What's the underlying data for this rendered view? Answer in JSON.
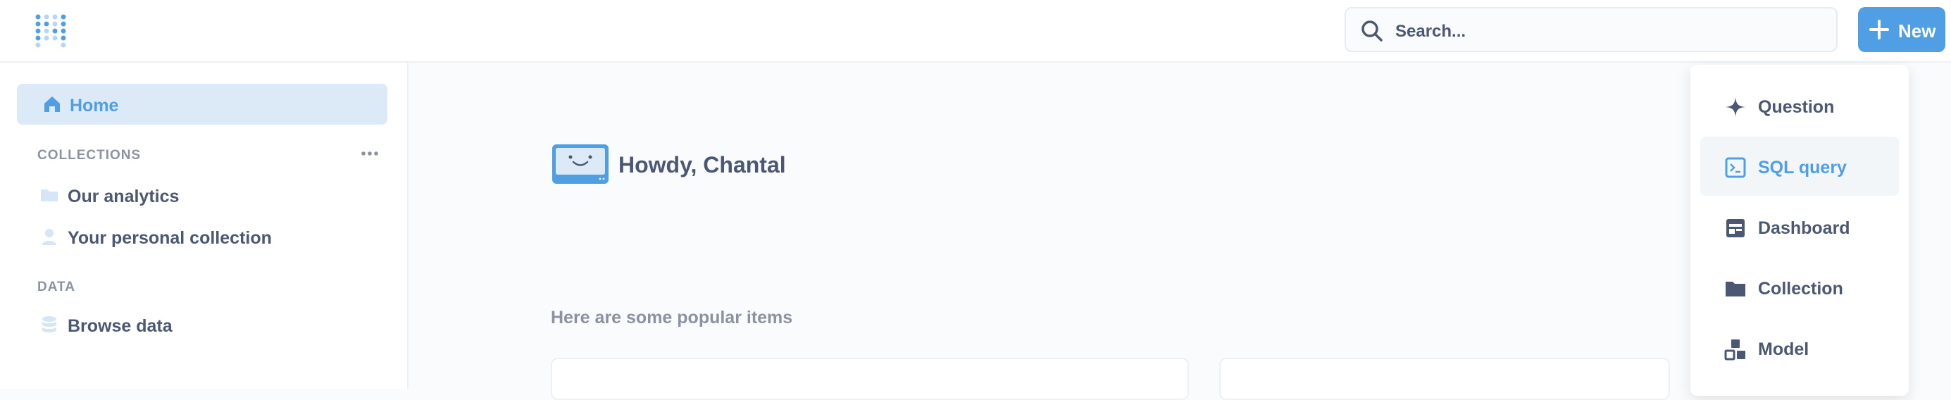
{
  "header": {
    "logo": "metabase-logo",
    "search_placeholder": "Search...",
    "new_button_label": "New"
  },
  "sidebar": {
    "home_label": "Home",
    "collections_title": "COLLECTIONS",
    "collections": [
      {
        "label": "Our analytics",
        "icon": "folder-icon"
      },
      {
        "label": "Your personal collection",
        "icon": "person-icon"
      }
    ],
    "data_title": "DATA",
    "data_items": [
      {
        "label": "Browse data",
        "icon": "database-icon"
      }
    ]
  },
  "main": {
    "greeting": "Howdy, Chantal",
    "popular_title": "Here are some popular items"
  },
  "new_menu": {
    "items": [
      {
        "label": "Question",
        "icon": "sparkle-icon"
      },
      {
        "label": "SQL query",
        "icon": "terminal-icon"
      },
      {
        "label": "Dashboard",
        "icon": "dashboard-icon"
      },
      {
        "label": "Collection",
        "icon": "folder-icon"
      },
      {
        "label": "Model",
        "icon": "model-icon"
      }
    ],
    "active_index": 1
  },
  "colors": {
    "brand": "#509ee3",
    "text": "#4c5773",
    "muted": "#8c93a0",
    "home_bg": "#dce9f7"
  }
}
